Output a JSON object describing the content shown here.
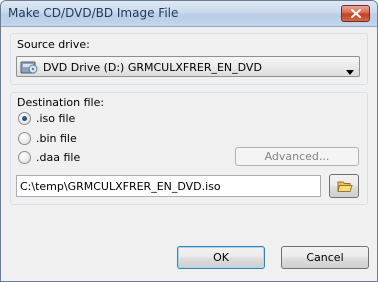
{
  "window": {
    "title": "Make CD/DVD/BD Image File"
  },
  "source": {
    "label": "Source drive:",
    "selected_drive": "DVD Drive (D:) GRMCULXFRER_EN_DVD"
  },
  "destination": {
    "label": "Destination file:",
    "formats": [
      {
        "label": ".iso file",
        "selected": true
      },
      {
        "label": ".bin file",
        "selected": false
      },
      {
        "label": ".daa file",
        "selected": false
      }
    ],
    "advanced_label": "Advanced...",
    "file_path": "C:\\temp\\GRMCULXFRER_EN_DVD.iso"
  },
  "buttons": {
    "ok": "OK",
    "cancel": "Cancel"
  },
  "colors": {
    "window_bg": "#f0f0f0",
    "title_text": "#1e395b",
    "close_red": "#c2401f",
    "radio_dot": "#0b2b57"
  },
  "icons": {
    "close": "close-icon",
    "drive": "dvd-drive-icon",
    "dropdown": "chevron-down-icon",
    "browse": "folder-open-icon"
  }
}
